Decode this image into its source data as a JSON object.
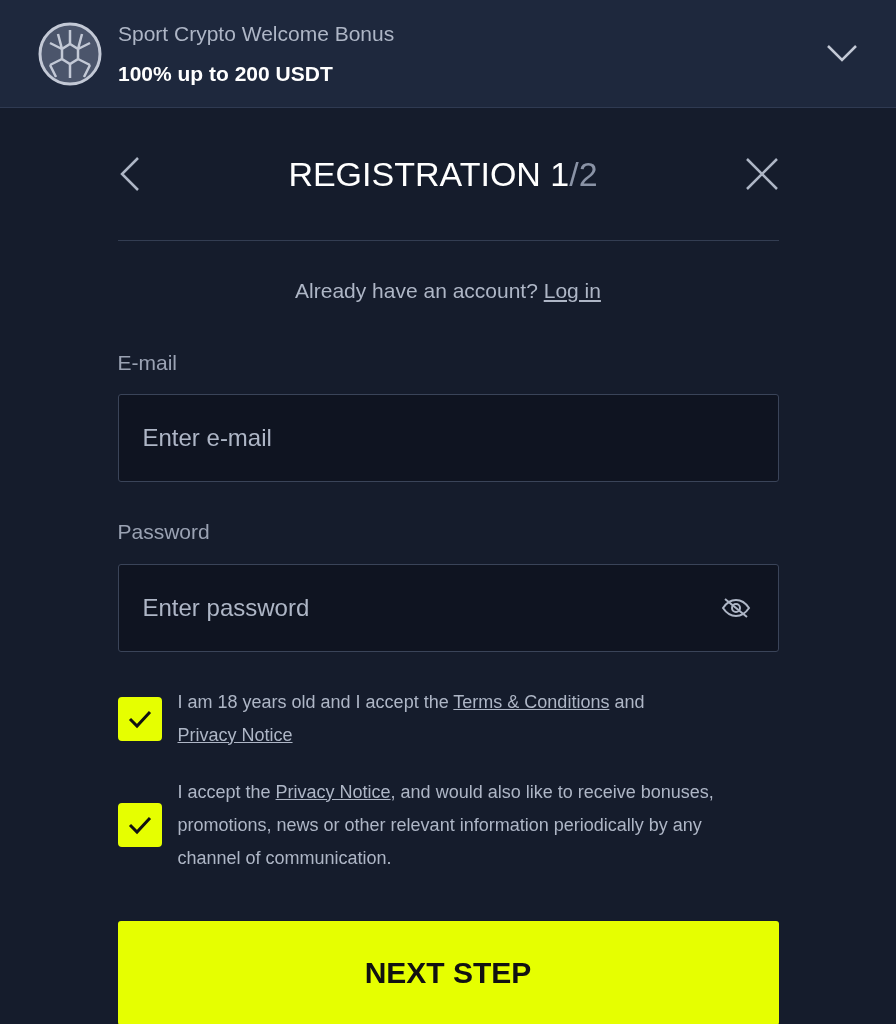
{
  "banner": {
    "title": "Sport Crypto Welcome Bonus",
    "offer": "100% up to 200 USDT",
    "expanded": false
  },
  "header": {
    "title": "REGISTRATION 1",
    "step_total": "/2"
  },
  "login_prompt": {
    "text": "Already have an account?",
    "link": "Log in"
  },
  "fields": [
    {
      "label": "E-mail",
      "placeholder": "Enter e-mail",
      "kind": "email"
    },
    {
      "label": "Password",
      "placeholder": "Enter password",
      "kind": "password"
    }
  ],
  "consents": [
    {
      "checked": true,
      "parts": [
        {
          "kind": "text",
          "text": "I am 18 years old and I accept the "
        },
        {
          "kind": "link",
          "text": "Terms & Conditions"
        },
        {
          "kind": "text",
          "text": " and "
        },
        {
          "kind": "link",
          "text": "Privacy Notice"
        }
      ]
    },
    {
      "checked": true,
      "parts": [
        {
          "kind": "text",
          "text": "I accept the "
        },
        {
          "kind": "link",
          "text": "Privacy Notice"
        },
        {
          "kind": "text",
          "text": ", and would also like to receive bonuses, promotions, news or other relevant information periodically by any channel of communication."
        }
      ]
    }
  ],
  "submit": "NEXT STEP"
}
